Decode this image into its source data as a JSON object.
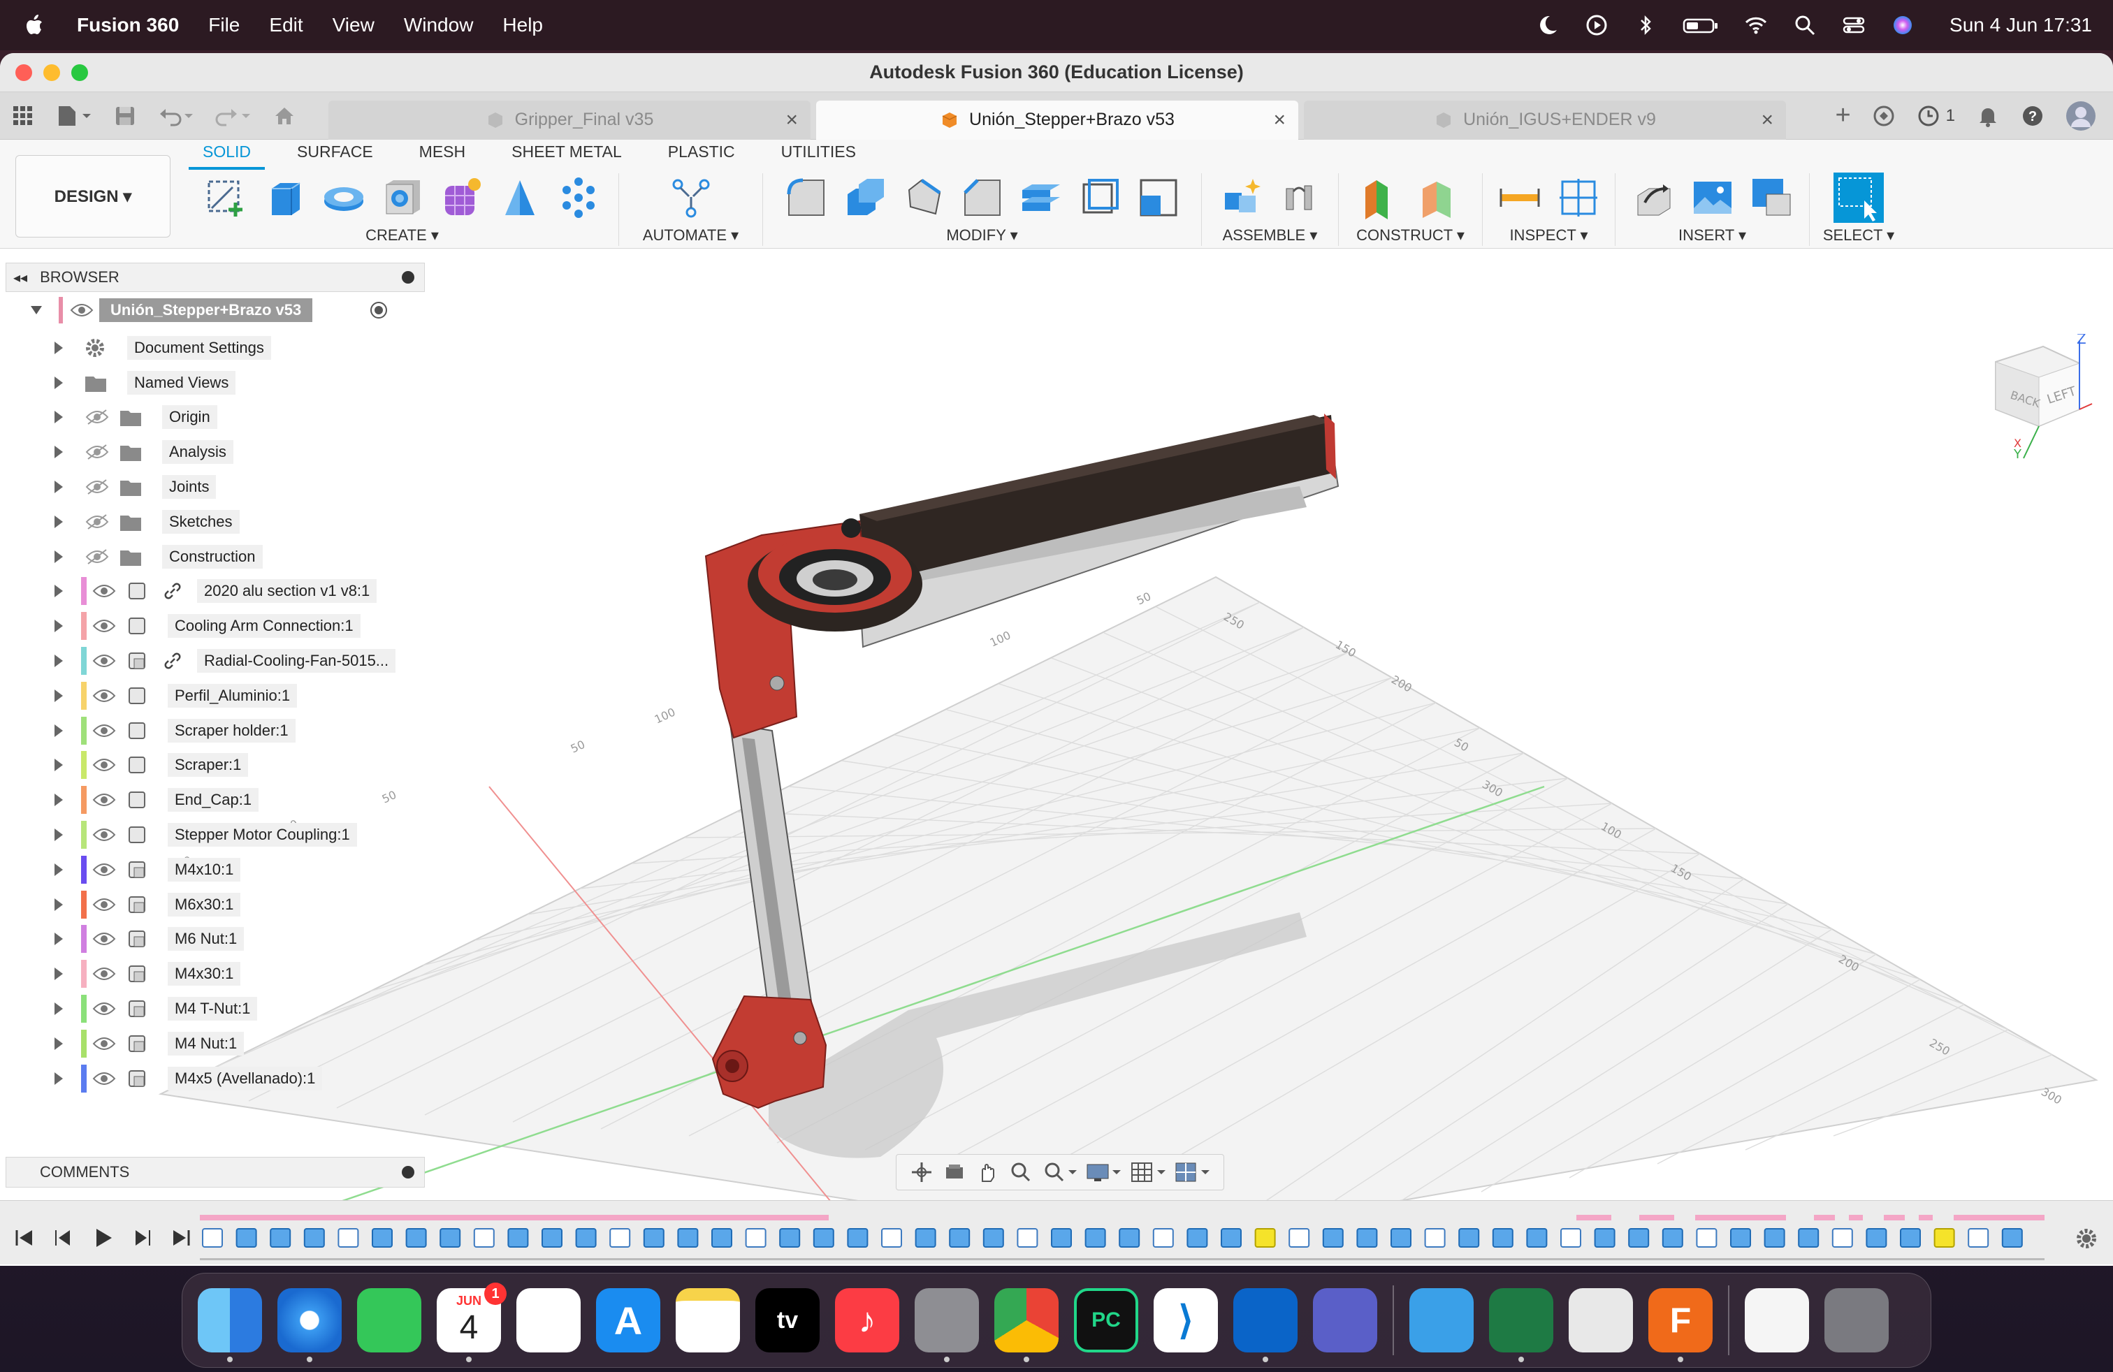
{
  "menubar": {
    "app_name": "Fusion 360",
    "menus": [
      "File",
      "Edit",
      "View",
      "Window",
      "Help"
    ],
    "clock": "Sun 4 Jun  17:31"
  },
  "window": {
    "title": "Autodesk Fusion 360 (Education License)"
  },
  "tabs": [
    {
      "label": "Gripper_Final v35",
      "active": false
    },
    {
      "label": "Unión_Stepper+Brazo v53",
      "active": true
    },
    {
      "label": "Unión_IGUS+ENDER v9",
      "active": false
    }
  ],
  "tabbar_right": {
    "job_count": "1"
  },
  "toolbar": {
    "workspace_label": "DESIGN ▾",
    "tool_tabs": [
      "SOLID",
      "SURFACE",
      "MESH",
      "SHEET METAL",
      "PLASTIC",
      "UTILITIES"
    ],
    "active_tab": "SOLID",
    "groups": [
      {
        "name": "CREATE ▾",
        "icons": [
          "sketch-icon",
          "extrude-icon",
          "revolve-icon",
          "hole-icon",
          "form-icon",
          "loft-icon",
          "pattern-icon"
        ]
      },
      {
        "name": "AUTOMATE ▾",
        "icons": [
          "automate-icon"
        ]
      },
      {
        "name": "MODIFY ▾",
        "icons": [
          "fillet-icon",
          "press-pull-icon",
          "shell-icon",
          "chamfer-icon",
          "combine-icon",
          "split-icon",
          "scale-icon"
        ]
      },
      {
        "name": "ASSEMBLE ▾",
        "icons": [
          "new-component-icon",
          "joint-icon"
        ]
      },
      {
        "name": "CONSTRUCT ▾",
        "icons": [
          "offset-plane-icon",
          "plane-angle-icon"
        ]
      },
      {
        "name": "INSPECT ▾",
        "icons": [
          "measure-icon",
          "section-analysis-icon"
        ]
      },
      {
        "name": "INSERT ▾",
        "icons": [
          "insert-derive-icon",
          "insert-image-icon",
          "decal-icon"
        ]
      },
      {
        "name": "SELECT ▾",
        "icons": [
          "select-icon"
        ]
      }
    ]
  },
  "browser": {
    "title": "BROWSER",
    "root": "Unión_Stepper+Brazo v53",
    "items": [
      {
        "label": "Document Settings",
        "type": "settings",
        "color": ""
      },
      {
        "label": "Named Views",
        "type": "folder",
        "color": ""
      },
      {
        "label": "Origin",
        "type": "folder-hidden",
        "color": ""
      },
      {
        "label": "Analysis",
        "type": "folder-hidden",
        "color": ""
      },
      {
        "label": "Joints",
        "type": "folder-hidden",
        "color": ""
      },
      {
        "label": "Sketches",
        "type": "folder-hidden",
        "color": ""
      },
      {
        "label": "Construction",
        "type": "folder-hidden",
        "color": ""
      },
      {
        "label": "2020 alu section v1 v8:1",
        "type": "linked",
        "color": "#e88ed6"
      },
      {
        "label": "Cooling Arm Connection:1",
        "type": "component",
        "color": "#f4a3a8"
      },
      {
        "label": "Radial-Cooling-Fan-5015...",
        "type": "linked-multi",
        "color": "#7fd6d6"
      },
      {
        "label": "Perfil_Aluminio:1",
        "type": "component",
        "color": "#f7d36b"
      },
      {
        "label": "Scraper holder:1",
        "type": "component",
        "color": "#9fe07a"
      },
      {
        "label": "Scraper:1",
        "type": "component",
        "color": "#c9e86a"
      },
      {
        "label": "End_Cap:1",
        "type": "component",
        "color": "#f59a62"
      },
      {
        "label": "Stepper Motor Coupling:1",
        "type": "component",
        "color": "#b7e57a"
      },
      {
        "label": "M4x10:1",
        "type": "multi",
        "color": "#6a4df0"
      },
      {
        "label": "M6x30:1",
        "type": "multi",
        "color": "#f2704a"
      },
      {
        "label": "M6 Nut:1",
        "type": "multi",
        "color": "#d07fe0"
      },
      {
        "label": "M4x30:1",
        "type": "multi",
        "color": "#f6b0c0"
      },
      {
        "label": "M4 T-Nut:1",
        "type": "multi",
        "color": "#8be07a"
      },
      {
        "label": "M4 Nut:1",
        "type": "multi",
        "color": "#a8e06a"
      },
      {
        "label": "M4x5 (Avellanado):1",
        "type": "multi",
        "color": "#5b7cf0"
      }
    ]
  },
  "comments": {
    "title": "COMMENTS"
  },
  "viewcube": {
    "face_front": "BACK",
    "face_side": "LEFT",
    "axis_z": "Z",
    "axis_x": "X",
    "axis_y": "Y"
  },
  "grid_labels": {
    "left_edge": [
      "100",
      "50",
      "50",
      "100",
      "150"
    ],
    "right_edge": [
      "50",
      "100",
      "150",
      "200",
      "250",
      "300"
    ],
    "top_edge": [
      "50",
      "100",
      "150",
      "200",
      "250",
      "300"
    ]
  },
  "dock": {
    "calendar_month": "JUN",
    "calendar_day": "4",
    "calendar_badge": "1",
    "tv_label": "tv",
    "pycharm_label": "PC"
  }
}
